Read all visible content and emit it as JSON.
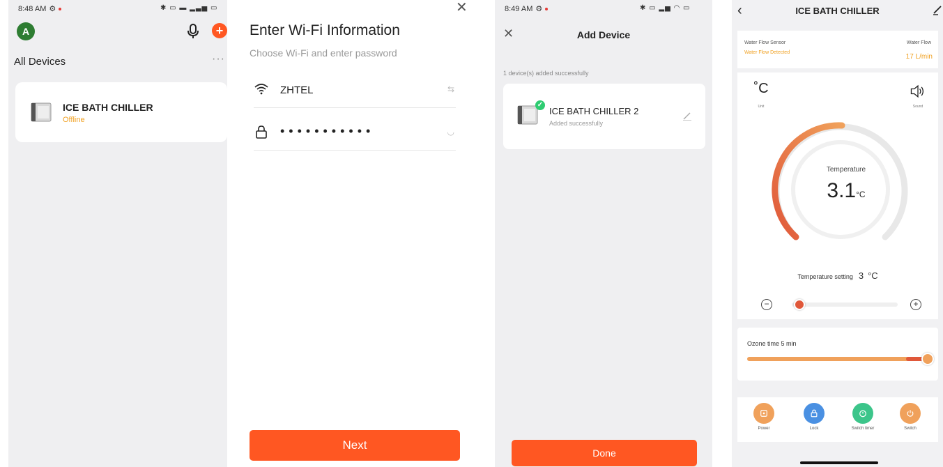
{
  "panel1": {
    "status_time": "8:48 AM",
    "avatar_letter": "A",
    "section_title": "All Devices",
    "more": "···",
    "device": {
      "name": "ICE BATH CHILLER",
      "status": "Offline"
    }
  },
  "panel2": {
    "title": "Enter Wi-Fi Information",
    "subtitle": "Choose Wi-Fi and enter password",
    "ssid": "ZHTEL",
    "password_mask": "•••••••••••",
    "next_label": "Next"
  },
  "panel3": {
    "status_time": "8:49 AM",
    "title": "Add Device",
    "added_text": "1 device(s) added successfully",
    "device": {
      "name": "ICE BATH CHILLER 2",
      "status": "Added successfully"
    },
    "done_label": "Done"
  },
  "panel4": {
    "title": "ICE BATH CHILLER",
    "sensor_label": "Water Flow Sensor",
    "sensor_status": "Water Flow Detected",
    "flow_label": "Water Flow",
    "flow_value": "17 L/min",
    "unit_label": "Unit",
    "sound_label": "Sound",
    "temp_label": "Temperature",
    "temp_value": "3.1",
    "temp_unit": "°C",
    "setting_label": "Temperature setting",
    "setting_value": "3",
    "setting_unit": "°C",
    "setting_level": 0.05,
    "ozone_label": "Ozone  time  5 min",
    "controls": [
      {
        "label": "Power",
        "color": "#f0a15b"
      },
      {
        "label": "Lock",
        "color": "#4a90e2"
      },
      {
        "label": "Switch timer",
        "color": "#3cc58a"
      },
      {
        "label": "Switch",
        "color": "#f0a15b"
      }
    ]
  },
  "colors": {
    "accent": "#ff5722",
    "offline": "#f0a020",
    "success": "#2ecc71"
  }
}
